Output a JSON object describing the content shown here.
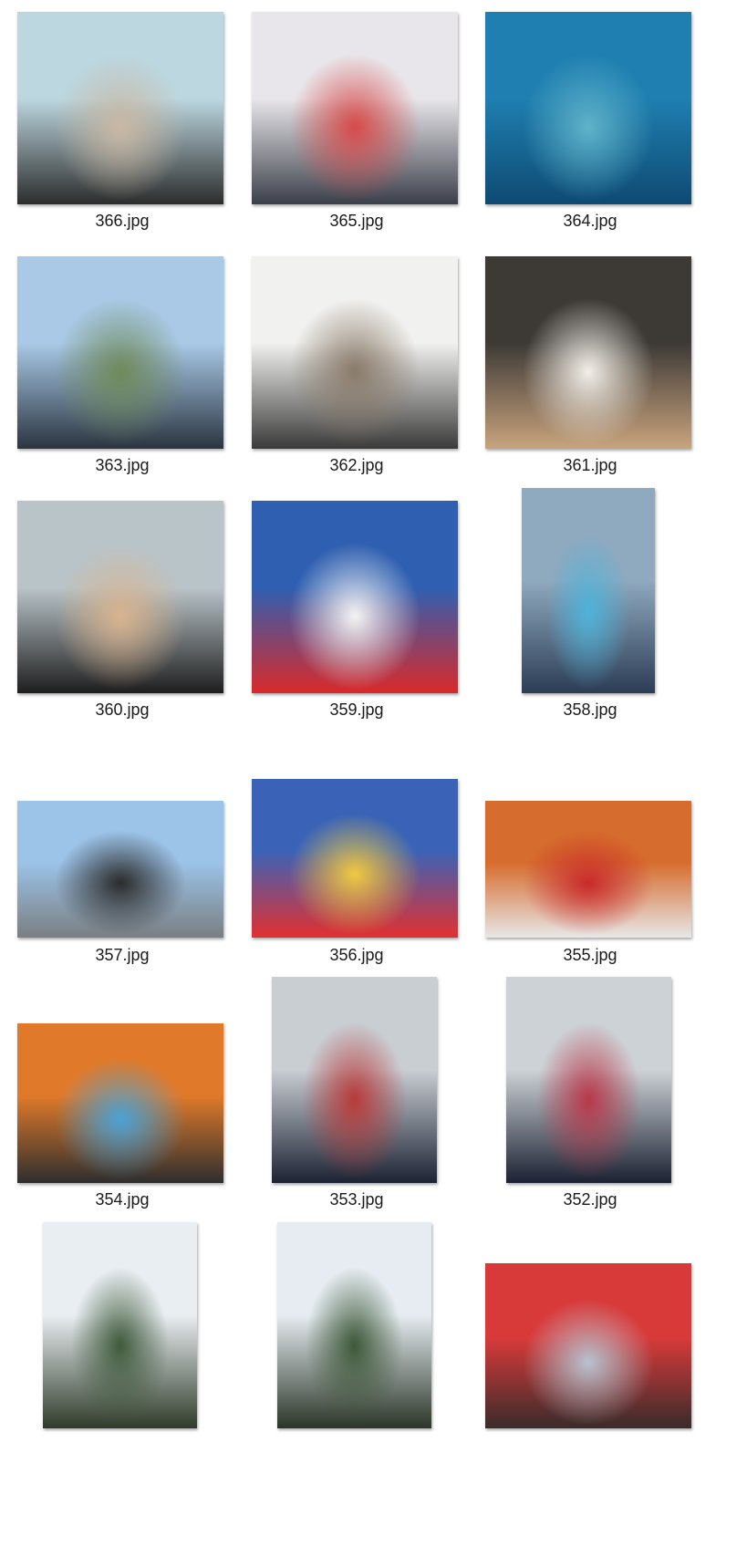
{
  "window": {
    "view": "Large icons"
  },
  "files": [
    {
      "name": "366.jpg",
      "icon": "image-thumbnail-man-carving-steak",
      "colors": [
        "#bcd7e0",
        "#2c2c2c",
        "#c9b8a3"
      ]
    },
    {
      "name": "365.jpg",
      "icon": "image-thumbnail-race-cars-garage",
      "colors": [
        "#e8e6ea",
        "#3b3f4a",
        "#d64a4a"
      ]
    },
    {
      "name": "364.jpg",
      "icon": "image-thumbnail-scuba-diver",
      "colors": [
        "#1f7fb0",
        "#0e4a73",
        "#5fb3c9"
      ]
    },
    {
      "name": "363.jpg",
      "icon": "image-thumbnail-sports-cars-track",
      "colors": [
        "#a9c9e6",
        "#2a3540",
        "#6f8a5a"
      ]
    },
    {
      "name": "362.jpg",
      "icon": "image-thumbnail-three-friends-brick-wall",
      "colors": [
        "#f1f1ef",
        "#3a3a3a",
        "#8a7b6a"
      ]
    },
    {
      "name": "361.jpg",
      "icon": "image-thumbnail-birthday-dinner",
      "colors": [
        "#3d3a36",
        "#c9a47e",
        "#f2efe9"
      ]
    },
    {
      "name": "360.jpg",
      "icon": "image-thumbnail-selfie-two-men",
      "colors": [
        "#b9c4c9",
        "#1e1e1e",
        "#d9b48f"
      ]
    },
    {
      "name": "359.jpg",
      "icon": "image-thumbnail-birelart-kart",
      "colors": [
        "#2f5fb0",
        "#d92a2a",
        "#f4f4f4"
      ]
    },
    {
      "name": "358.jpg",
      "icon": "image-thumbnail-racer-standing-road",
      "colors": [
        "#8fa9bf",
        "#2c3d55",
        "#4fb3d9"
      ]
    },
    {
      "name": "357.jpg",
      "icon": "image-thumbnail-friends-on-barrier",
      "colors": [
        "#9cc3e8",
        "#7a7f82",
        "#2b2b2b"
      ]
    },
    {
      "name": "356.jpg",
      "icon": "image-thumbnail-kart-number-23",
      "colors": [
        "#3a63b7",
        "#e23030",
        "#f0c940"
      ]
    },
    {
      "name": "355.jpg",
      "icon": "image-thumbnail-team-group-photo",
      "colors": [
        "#d66c2d",
        "#e7e7e7",
        "#c92a2a"
      ]
    },
    {
      "name": "354.jpg",
      "icon": "image-thumbnail-racers-sitting",
      "colors": [
        "#e07a2a",
        "#2e2e2e",
        "#4aa3d6"
      ]
    },
    {
      "name": "353.jpg",
      "icon": "image-thumbnail-racer-walking-paddock",
      "colors": [
        "#c9ced3",
        "#1c2233",
        "#b83a3a"
      ]
    },
    {
      "name": "352.jpg",
      "icon": "image-thumbnail-racer-hands-on-hips",
      "colors": [
        "#cdd2d6",
        "#1b2132",
        "#b8384a"
      ]
    },
    {
      "name": "",
      "icon": "image-thumbnail-man-in-snow",
      "colors": [
        "#e9eef2",
        "#2f3b2a",
        "#3f5a3c"
      ]
    },
    {
      "name": "",
      "icon": "image-thumbnail-man-in-snow-2",
      "colors": [
        "#e6ecf1",
        "#2b3528",
        "#3d5838"
      ]
    },
    {
      "name": "",
      "icon": "image-thumbnail-racing-helmet",
      "colors": [
        "#d83a3a",
        "#3a2b2b",
        "#b7c3cf"
      ]
    }
  ]
}
